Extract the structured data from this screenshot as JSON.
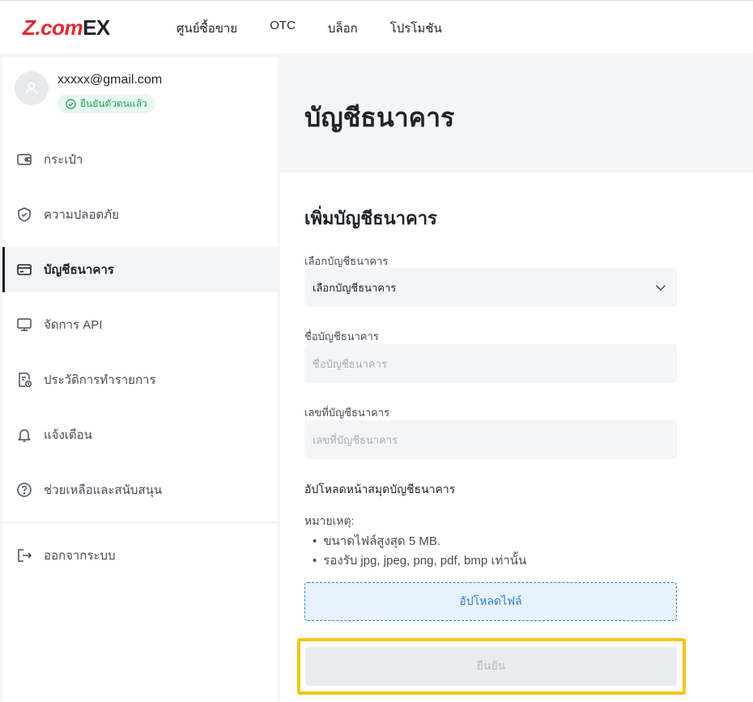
{
  "header": {
    "logo_main": "Z.com",
    "logo_suffix": "EX",
    "nav": [
      "ศูนย์ซื้อขาย",
      "OTC",
      "บล็อก",
      "โปรโมชัน"
    ]
  },
  "profile": {
    "email": "xxxxx@gmail.com",
    "status": "ยืนยันตัวตนแล้ว"
  },
  "sidebar": {
    "items": [
      {
        "label": "กระเป๋า",
        "icon": "wallet-icon"
      },
      {
        "label": "ความปลอดภัย",
        "icon": "shield-icon"
      },
      {
        "label": "บัญชีธนาคาร",
        "icon": "card-icon",
        "active": true
      },
      {
        "label": "จัดการ API",
        "icon": "monitor-icon"
      },
      {
        "label": "ประวัติการทำรายการ",
        "icon": "history-icon"
      },
      {
        "label": "แจ้งเตือน",
        "icon": "bell-icon"
      },
      {
        "label": "ช่วยเหลือและสนับสนุน",
        "icon": "help-icon"
      }
    ],
    "logout": {
      "label": "ออกจากระบบ",
      "icon": "logout-icon"
    }
  },
  "main": {
    "page_title": "บัญชีธนาคาร",
    "card_title": "เพิ่มบัญชีธนาคาร",
    "bank_select": {
      "label": "เลือกบัญชีธนาคาร",
      "value": "เลือกบัญชีธนาคาร"
    },
    "account_name": {
      "label": "ชื่อบัญชีธนาคาร",
      "placeholder": "ชื่อบัญชีธนาคาร"
    },
    "account_number": {
      "label": "เลขที่บัญชีธนาคาร",
      "placeholder": "เลขที่บัญชีธนาคาร"
    },
    "upload_section": "อัปโหลดหน้าสมุดบัญชีธนาคาร",
    "note_title": "หมายเหตุ:",
    "notes": [
      "ขนาดไฟล์สูงสุด 5 MB.",
      "รองรับ jpg, jpeg, png, pdf, bmp เท่านั้น"
    ],
    "upload_button": "อัปโหลดไฟล์",
    "confirm_button": "ยืนยัน"
  },
  "colors": {
    "brand_red": "#e3272d",
    "verified_green": "#19a75c",
    "upload_blue": "#2f7fd3",
    "highlight_yellow": "#f5c518"
  }
}
